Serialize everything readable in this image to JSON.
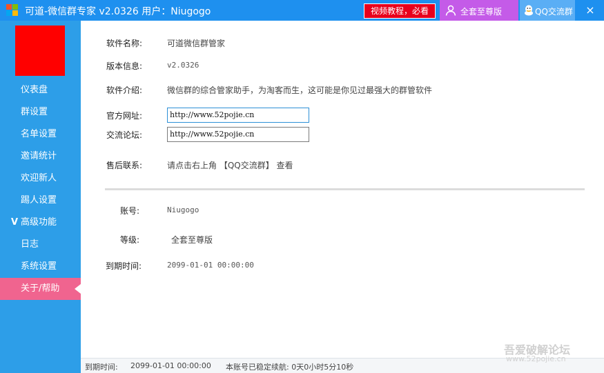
{
  "titlebar": {
    "title": "可道-微信群专家 v2.0326  用户：Niugogo",
    "video_button": "视频教程，必看",
    "vip_button": "全套至尊版",
    "qq_button": "QQ交流群",
    "close": "×"
  },
  "colors": {
    "titlebar": "#1e90ef",
    "sidebar": "#2d9ee8",
    "active_nav": "#f0648f",
    "video_button": "#e8001c",
    "vip_button": "#c45be8",
    "avatar": "#ff0000"
  },
  "sidebar": {
    "items": [
      {
        "label": "仪表盘"
      },
      {
        "label": "群设置"
      },
      {
        "label": "名单设置"
      },
      {
        "label": "邀请统计"
      },
      {
        "label": "欢迎新人"
      },
      {
        "label": "踢人设置"
      },
      {
        "label": "高级功能",
        "prefix": "V"
      },
      {
        "label": "日志"
      },
      {
        "label": "系统设置"
      },
      {
        "label": "关于/帮助",
        "active": true
      }
    ]
  },
  "about": {
    "software_name_label": "软件名称:",
    "software_name": "可道微信群管家",
    "version_label": "版本信息:",
    "version": "v2.0326",
    "intro_label": "软件介绍:",
    "intro": "微信群的综合管家助手，为淘客而生，这可能是你见过最强大的群管软件",
    "website_label": "官方网址:",
    "website": "http://www.52pojie.cn",
    "forum_label": "交流论坛:",
    "forum": "http://www.52pojie.cn",
    "support_label": "售后联系:",
    "support": "请点击右上角 【QQ交流群】 查看"
  },
  "account": {
    "account_label": "账号:",
    "account": "Niugogo",
    "level_label": "等级:",
    "level": "全套至尊版",
    "expiry_label": "到期时间:",
    "expiry": "2099-01-01 00:00:00"
  },
  "statusbar": {
    "expiry_label": "到期时间:",
    "expiry": "2099-01-01 00:00:00",
    "runtime": "本账号已稳定续航: 0天0小时5分10秒"
  },
  "watermark": {
    "title": "吾爱破解论坛",
    "url": "www.52pojie.cn"
  }
}
